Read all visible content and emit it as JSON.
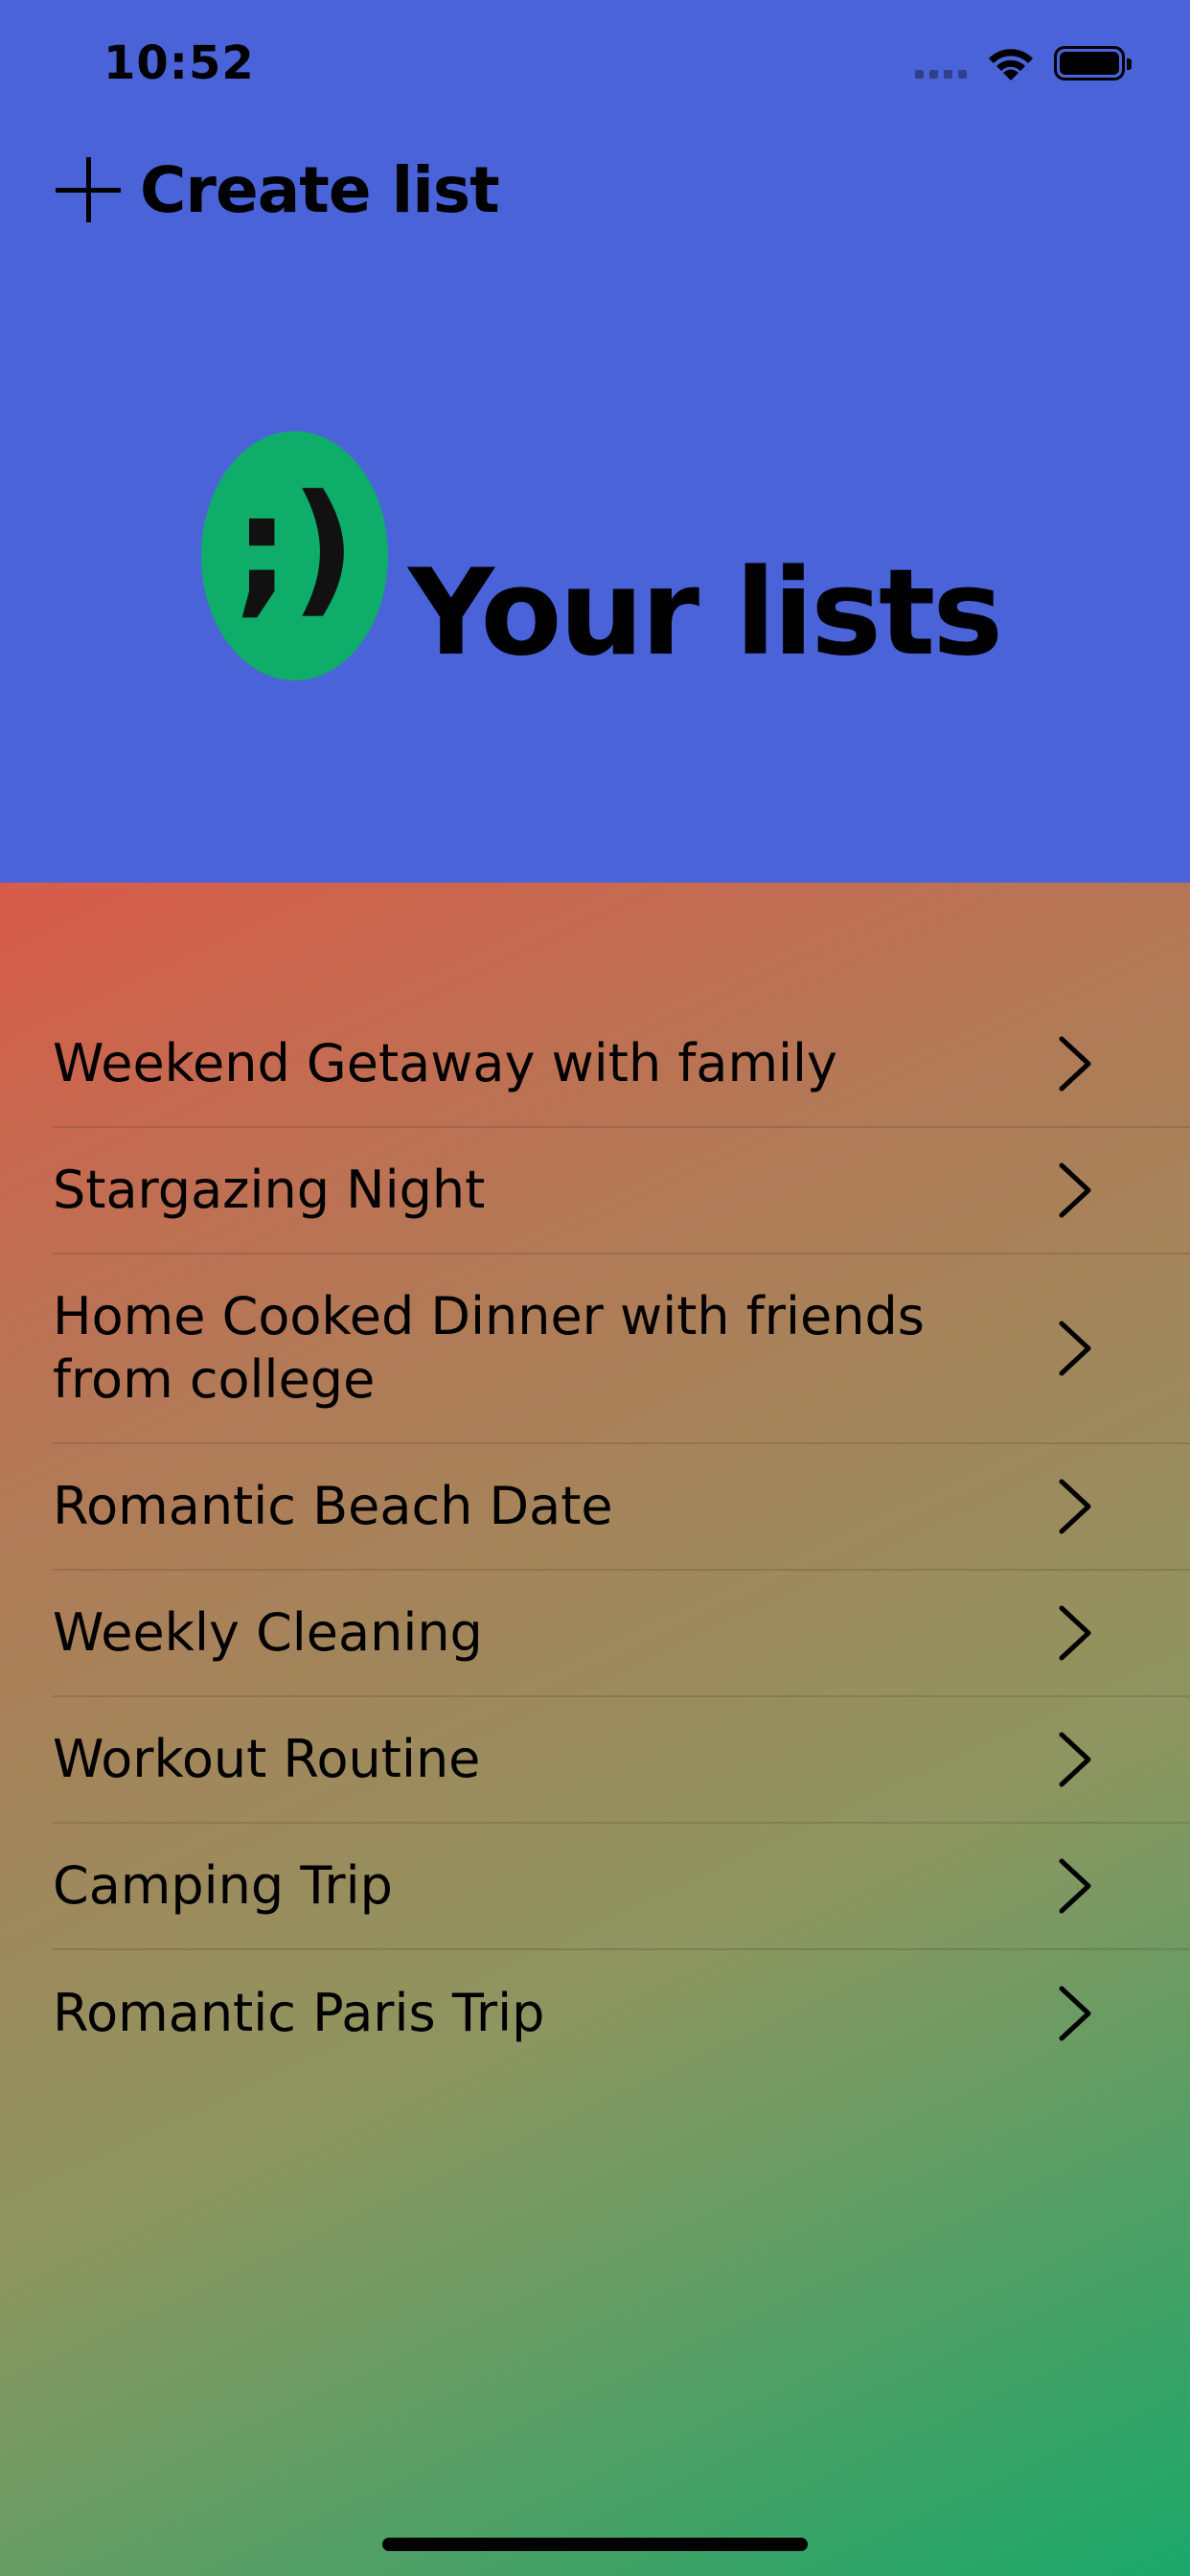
{
  "status_bar": {
    "time": "10:52"
  },
  "header": {
    "create_label": "Create list",
    "logo_glyph": ";)",
    "title": "Your lists"
  },
  "lists": [
    {
      "label": "Weekend Getaway with family"
    },
    {
      "label": "Stargazing Night"
    },
    {
      "label": "Home Cooked Dinner with friends from college"
    },
    {
      "label": "Romantic Beach Date"
    },
    {
      "label": "Weekly Cleaning"
    },
    {
      "label": "Workout Routine"
    },
    {
      "label": "Camping Trip"
    },
    {
      "label": "Romantic Paris Trip"
    }
  ],
  "icons": {
    "create": "plus-icon",
    "row": "chevron-right-icon",
    "wifi": "wifi-icon",
    "battery": "battery-icon"
  },
  "colors": {
    "header_bg": "#4a63d8",
    "logo_bg": "#0ead69",
    "gradient_start": "#d85b4a",
    "gradient_end": "#1aa86a"
  }
}
